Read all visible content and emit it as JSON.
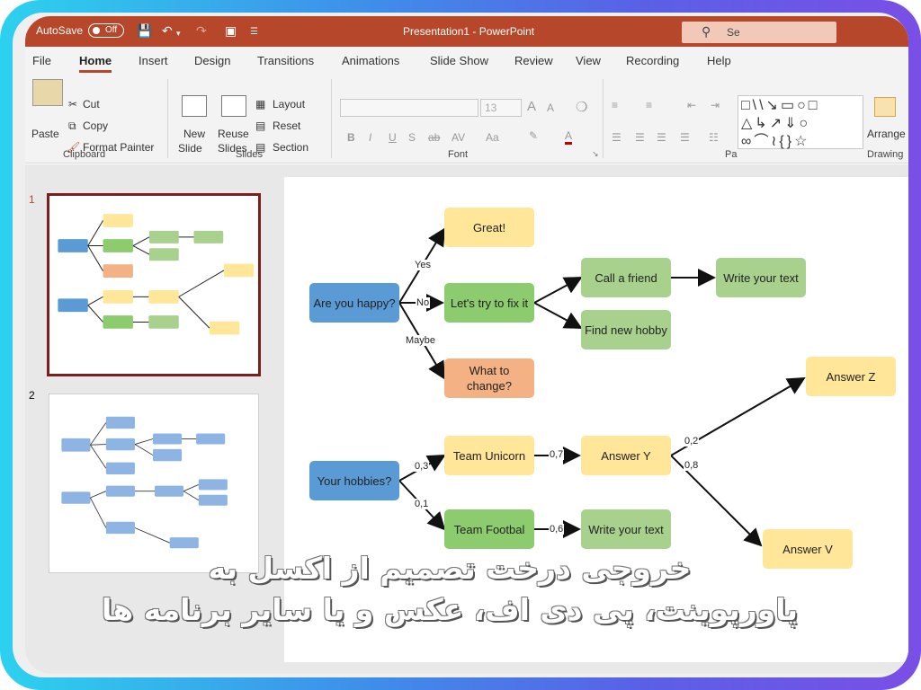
{
  "titlebar": {
    "autosave_label": "AutoSave",
    "autosave_state": "Off",
    "doc_title": "Presentation1  -  PowerPoint",
    "search_text": "Se"
  },
  "tabs": [
    "File",
    "Home",
    "Insert",
    "Design",
    "Transitions",
    "Animations",
    "Slide Show",
    "Review",
    "View",
    "Recording",
    "Help"
  ],
  "active_tab": "Home",
  "ribbon": {
    "clipboard": {
      "paste": "Paste",
      "cut": "Cut",
      "copy": "Copy",
      "format_painter": "Format Painter",
      "label": "Clipboard"
    },
    "slides": {
      "new_slide_1": "New",
      "new_slide_2": "Slide",
      "reuse_1": "Reuse",
      "reuse_2": "Slides",
      "layout": "Layout",
      "reset": "Reset",
      "section": "Section",
      "label": "Slides"
    },
    "font": {
      "size": "13",
      "label": "Font",
      "bold": "B",
      "italic": "I",
      "underline": "U",
      "strike": "S",
      "spacing": "AV",
      "case": "Aa",
      "grow": "A",
      "shrink": "A"
    },
    "paragraph": {
      "label": "Pa"
    },
    "drawing": {
      "arrange": "Arrange",
      "label": "Drawing"
    }
  },
  "thumbnails": {
    "numbers": [
      "1",
      "2"
    ]
  },
  "slide": {
    "nodes": {
      "are_you_happy": "Are you happy?",
      "great": "Great!",
      "fix": "Let's try to fix it",
      "what_change": "What to change?",
      "call_friend": "Call a friend",
      "new_hobby": "Find new hobby",
      "write1": "Write your text",
      "hobbies": "Your hobbies?",
      "unicorn": "Team Unicorn",
      "football": "Team Footbal",
      "answer_y": "Answer Y",
      "write2": "Write your text",
      "answer_z": "Answer Z",
      "answer_v": "Answer V"
    },
    "edges": {
      "yes": "Yes",
      "no": "No",
      "maybe": "Maybe",
      "e03": "0,3",
      "e01": "0,1",
      "e07": "0,7",
      "e06": "0,6",
      "e02": "0,2",
      "e08": "0,8"
    }
  },
  "caption": {
    "line1": "خروجی درخت تصمیم از اکسل به",
    "line2": "پاورپوینت، پی دی اف، عکس و یا سایر برنامه ها"
  },
  "colors": {
    "blue": "#5b9bd5",
    "yellow": "#ffe699",
    "green": "#8ccc6e",
    "light_green": "#a9d18e",
    "orange": "#f4b183",
    "accent": "#b7472a"
  }
}
